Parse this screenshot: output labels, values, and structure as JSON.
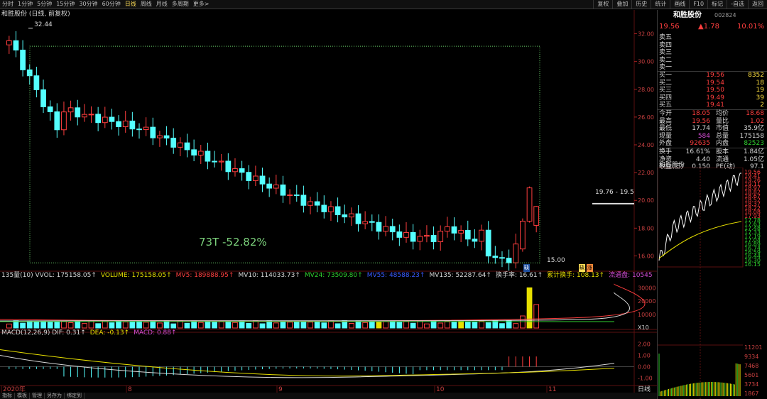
{
  "toolbar": {
    "items": [
      "分时",
      "1分钟",
      "5分钟",
      "15分钟",
      "30分钟",
      "60分钟",
      "日线",
      "周线",
      "月线",
      "多周期",
      "更多>"
    ],
    "active": "日线",
    "right_items": [
      "复权",
      "叠加",
      "历史",
      "统计",
      "画线",
      "F10",
      "标记",
      "-自选",
      "返回"
    ]
  },
  "main_chart": {
    "title": "和胜股份 (日线, 前复权)",
    "high_label": "32.44",
    "low_label": "15.00",
    "annotation": "73T  -52.82%",
    "price_box_label": "19.76 - 19.5",
    "y_ticks": [
      "32.00",
      "30.00",
      "28.00",
      "26.00",
      "24.00",
      "22.00",
      "20.00",
      "18.00",
      "16.00"
    ],
    "tag_left": "缺",
    "tag_right_1": "缺",
    "tag_right_2": "涨"
  },
  "volume_panel": {
    "legend": [
      {
        "text": "135量(10) VVOL: 175158.05↑",
        "color": "#d8d8d8"
      },
      {
        "text": "VOLUME: 175158.05↑",
        "color": "#e8e000"
      },
      {
        "text": "MV5: 189888.95↑",
        "color": "#ff3e3e"
      },
      {
        "text": "MV10: 114033.73↑",
        "color": "#d8d8d8"
      },
      {
        "text": "MV24: 73509.80↑",
        "color": "#2fd12f"
      },
      {
        "text": "MV55: 48588.23↑",
        "color": "#3a5bff"
      },
      {
        "text": "MV135: 52287.64↑",
        "color": "#d8d8d8"
      },
      {
        "text": "换手率: 16.61↑",
        "color": "#d8d8d8"
      },
      {
        "text": "累计换手: 108.13↑",
        "color": "#e8e000"
      },
      {
        "text": "流通盘: 10545",
        "color": "#d24cd2"
      }
    ],
    "y_ticks": [
      "30000",
      "20000",
      "10000",
      "X10"
    ]
  },
  "macd_panel": {
    "legend": [
      {
        "text": "MACD(12,26,9) DIF: 0.31↑",
        "color": "#d8d8d8"
      },
      {
        "text": "DEA: -0.13↑",
        "color": "#e8e000"
      },
      {
        "text": "MACD: 0.88↑",
        "color": "#d24cd2"
      }
    ],
    "y_ticks": [
      "2.00",
      "1.00",
      "0.00",
      "-1.00"
    ]
  },
  "x_axis": {
    "labels": [
      "2020年",
      "8",
      "9",
      "10",
      "11"
    ],
    "right_label": "日线"
  },
  "bottom_tabs": [
    "指标",
    "模板",
    "管理",
    "另存为",
    "绑定到"
  ],
  "quote": {
    "name": "和胜股份",
    "code": "002824",
    "price": "19.56",
    "change": "▲1.78",
    "pct": "10.01%",
    "asks": [
      {
        "label": "卖五",
        "price": "",
        "vol": ""
      },
      {
        "label": "卖四",
        "price": "",
        "vol": ""
      },
      {
        "label": "卖三",
        "price": "",
        "vol": ""
      },
      {
        "label": "卖二",
        "price": "",
        "vol": ""
      },
      {
        "label": "卖一",
        "price": "",
        "vol": ""
      }
    ],
    "bids": [
      {
        "label": "买一",
        "price": "19.56",
        "vol": "8352"
      },
      {
        "label": "买二",
        "price": "19.54",
        "vol": "18"
      },
      {
        "label": "买三",
        "price": "19.50",
        "vol": "19"
      },
      {
        "label": "买四",
        "price": "19.49",
        "vol": "39"
      },
      {
        "label": "买五",
        "price": "19.41",
        "vol": "2"
      }
    ],
    "stats": [
      {
        "l1": "今开",
        "v1": "18.05",
        "c1": "red",
        "l2": "均价",
        "v2": "18.68",
        "c2": "red"
      },
      {
        "l1": "最高",
        "v1": "19.56",
        "c1": "red",
        "l2": "量比",
        "v2": "1.02",
        "c2": "red"
      },
      {
        "l1": "最低",
        "v1": "17.74",
        "c1": "wht",
        "l2": "市值",
        "v2": "35.9亿",
        "c2": "wht"
      },
      {
        "l1": "现量",
        "v1": "584",
        "c1": "mag",
        "l2": "总量",
        "v2": "175158",
        "c2": "wht"
      },
      {
        "l1": "外盘",
        "v1": "92635",
        "c1": "red",
        "l2": "内盘",
        "v2": "82523",
        "c2": "grn"
      }
    ],
    "stats2": [
      {
        "l1": "换手",
        "v1": "16.61%",
        "l2": "股本",
        "v2": "1.84亿"
      },
      {
        "l1": "净资",
        "v1": "4.40",
        "l2": "流通",
        "v2": "1.05亿"
      },
      {
        "l1": "收益(三)",
        "v1": "0.150",
        "l2": "PE(动)",
        "v2": "97.1"
      }
    ]
  },
  "intraday": {
    "title": "和胜股份",
    "price_ticks": [
      "19.56",
      "19.41",
      "19.26",
      "19.11",
      "18.97",
      "18.82",
      "18.67",
      "18.52",
      "18.37",
      "18.22",
      "18.08",
      "17.93",
      "17.78",
      "17.63",
      "17.48",
      "17.33",
      "17.19",
      "17.04",
      "16.89",
      "16.74",
      "16.59",
      "16.44",
      "16.30",
      "16.15"
    ],
    "vol_ticks": [
      "11201",
      "9334",
      "7468",
      "5601",
      "3734",
      "1867"
    ]
  },
  "colors": {
    "up": "#ff3e3e",
    "down": "#54ffff",
    "bg": "#000000",
    "grid": "#3a1010",
    "accent": "#ffde57"
  }
}
